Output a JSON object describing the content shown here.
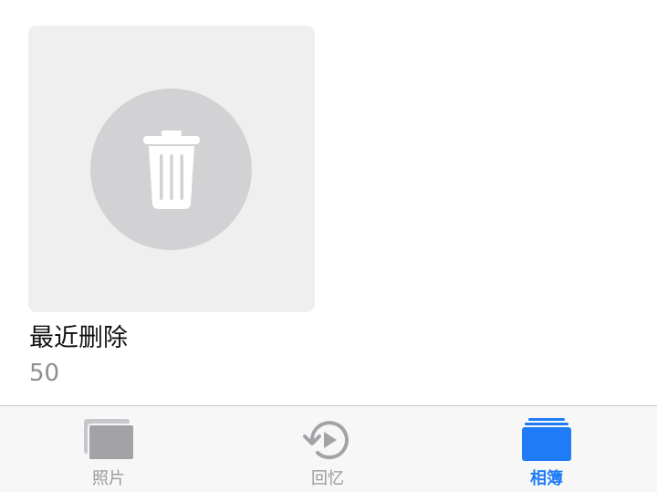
{
  "album": {
    "title": "最近删除",
    "count": "50",
    "icon": "trash-icon"
  },
  "tab_bar": {
    "tabs": [
      {
        "label": "照片",
        "icon": "photos-icon",
        "active": false
      },
      {
        "label": "回忆",
        "icon": "memories-icon",
        "active": false
      },
      {
        "label": "相簿",
        "icon": "albums-icon",
        "active": true
      }
    ]
  },
  "colors": {
    "accent": "#1f7cf6",
    "inactive": "#9a9a9e",
    "card_bg": "#efeff0",
    "circle_bg": "#d2d2d4"
  }
}
